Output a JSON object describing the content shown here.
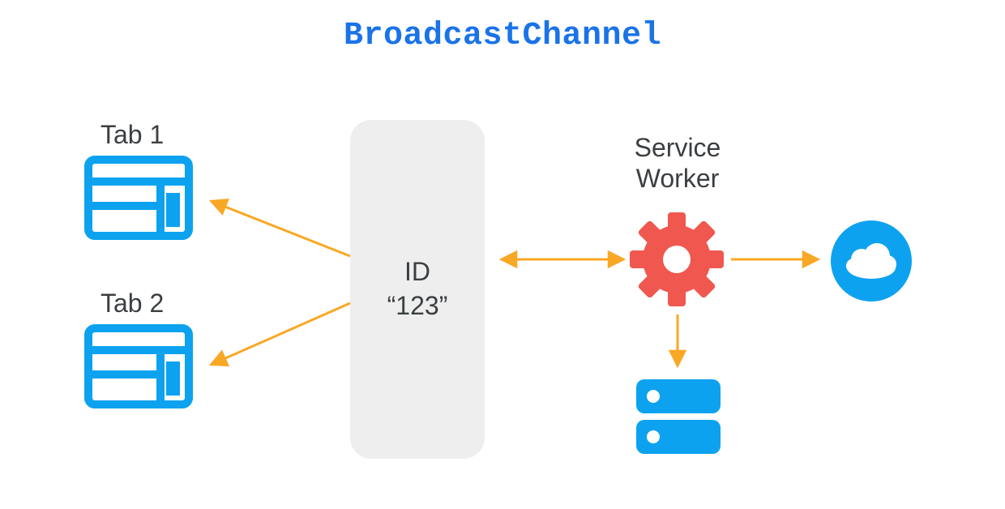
{
  "title": "BroadcastChannel",
  "tabs": [
    {
      "label": "Tab 1"
    },
    {
      "label": "Tab 2"
    }
  ],
  "channel": {
    "label_line1": "ID",
    "label_line2": "“123”"
  },
  "service_worker": {
    "label_line1": "Service",
    "label_line2": "Worker"
  },
  "icons": {
    "tab": "browser-window-icon",
    "gear": "gear-icon",
    "db": "database-icon",
    "cloud": "cloud-icon"
  },
  "colors": {
    "accent_blue": "#0da2ef",
    "title_blue": "#1a73e8",
    "gear_red": "#f0574e",
    "arrow_orange": "#f9a825",
    "text": "#3b3f42",
    "box_bg": "#eeeeee"
  }
}
